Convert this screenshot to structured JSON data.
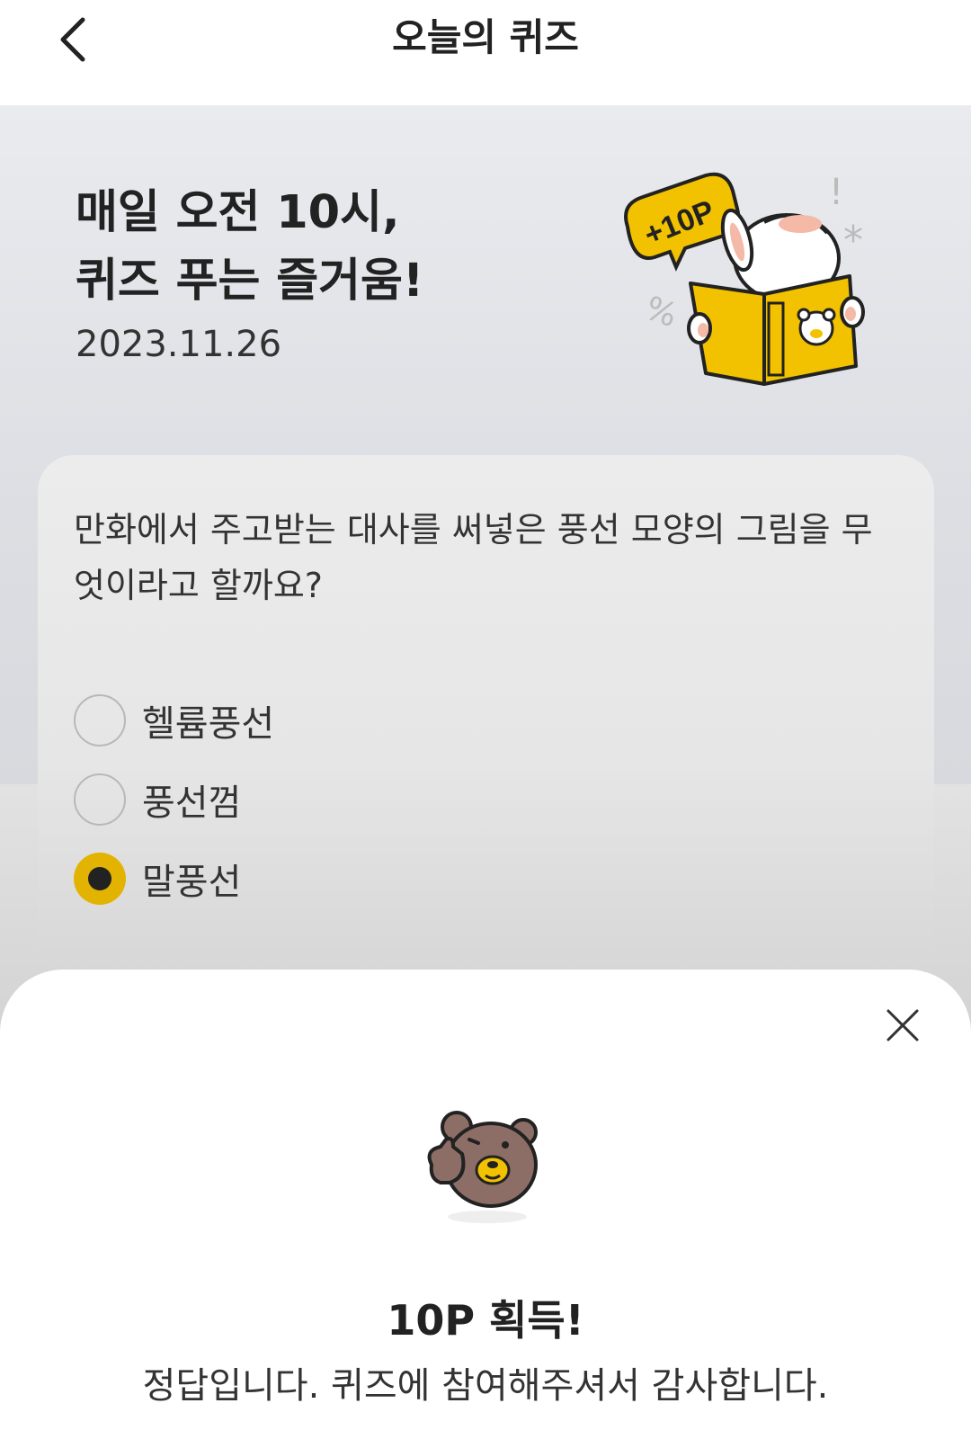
{
  "header": {
    "title": "오늘의 퀴즈"
  },
  "hero": {
    "title_line1": "매일 오전 10시,",
    "title_line2": "퀴즈 푸는 즐거움!",
    "date": "2023.11.26",
    "badge": "+10P"
  },
  "quiz": {
    "question": "만화에서 주고받는 대사를 써넣은 풍선 모양의 그림을 무엇이라고 할까요?",
    "options": [
      {
        "label": "헬륨풍선",
        "selected": false
      },
      {
        "label": "풍선껌",
        "selected": false
      },
      {
        "label": "말풍선",
        "selected": true
      }
    ]
  },
  "result": {
    "title": "10P 획득!",
    "message": "정답입니다. 퀴즈에 참여해주셔서 감사합니다."
  },
  "colors": {
    "accent": "#e2b301",
    "book": "#f2c200",
    "bear": "#8c6e66"
  },
  "icons": {
    "back": "chevron-left-icon",
    "close": "close-icon"
  }
}
